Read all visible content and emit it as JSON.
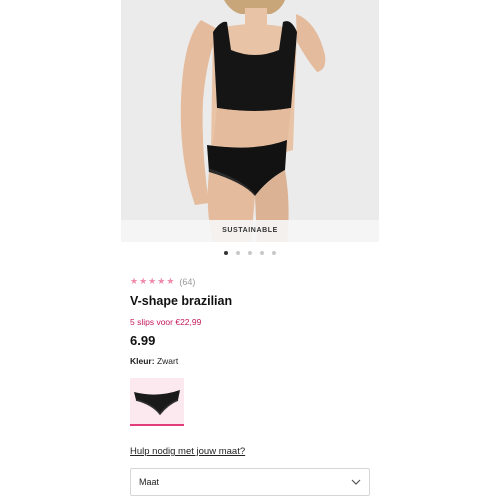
{
  "product": {
    "badge": "SUSTAINABLE",
    "rating": {
      "stars": 5,
      "filled": 5,
      "count_label": "(64)"
    },
    "title": "V-shape brazilian",
    "promo": "5 slips voor €22,99",
    "price": "6.99",
    "color": {
      "label": "Kleur:",
      "value": "Zwart"
    },
    "size_help": "Hulp nodig met jouw maat?",
    "size_select": {
      "label": "Maat"
    }
  },
  "carousel": {
    "total": 5,
    "active": 1
  },
  "icons": {
    "star": "star-icon",
    "chevron": "chevron-down-icon"
  },
  "colors": {
    "accent": "#e23d7a",
    "promo": "#c2185b",
    "star": "#f08aa9"
  }
}
